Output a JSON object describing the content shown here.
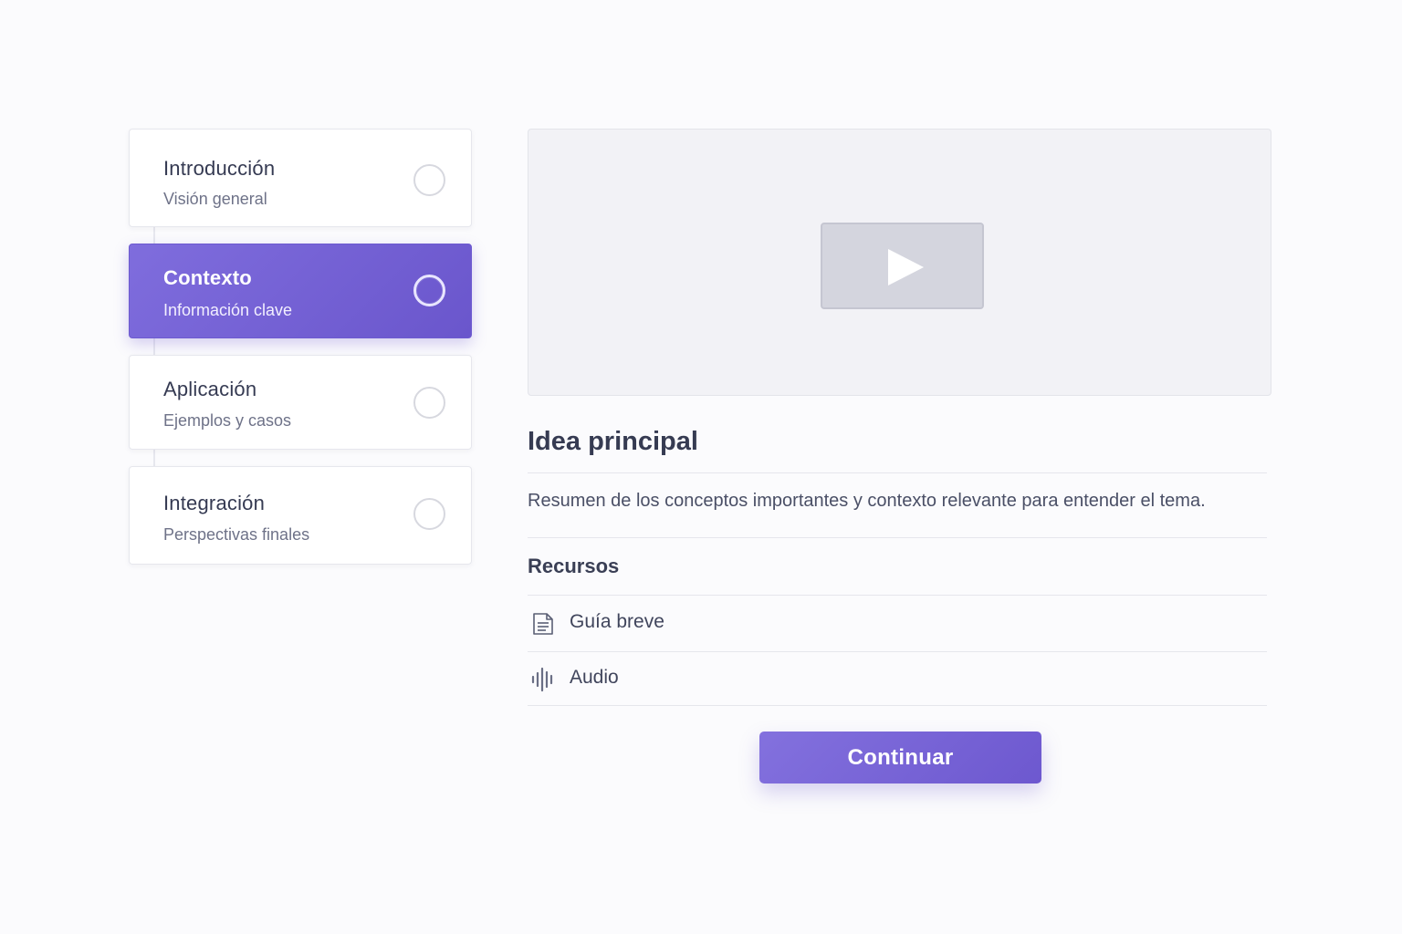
{
  "steps": [
    {
      "title": "Introducción",
      "subtitle": "Visión general",
      "active": false
    },
    {
      "title": "Contexto",
      "subtitle": "Información clave",
      "active": true
    },
    {
      "title": "Aplicación",
      "subtitle": "Ejemplos y casos",
      "active": false
    },
    {
      "title": "Integración",
      "subtitle": "Perspectivas finales",
      "active": false
    }
  ],
  "video": {
    "icon": "play-icon"
  },
  "content": {
    "heading": "Idea principal",
    "summary": "Resumen de los conceptos importantes y contexto relevante para entender el tema.",
    "resources_heading": "Recursos",
    "resources": [
      {
        "label": "Guía breve",
        "icon": "document-icon"
      },
      {
        "label": "Audio",
        "icon": "audio-wave-icon"
      }
    ]
  },
  "actions": {
    "continue_label": "Continuar"
  },
  "colors": {
    "accent": "#7360d4",
    "background": "#fbfbfd",
    "text": "#363b52"
  }
}
